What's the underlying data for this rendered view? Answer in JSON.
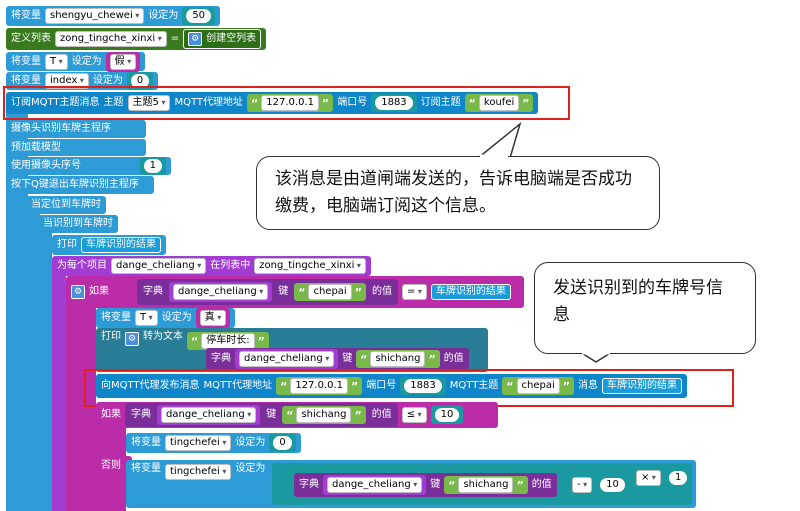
{
  "blocks": {
    "set_var": "将变量",
    "set_to": "设定为",
    "var_shengyu": "shengyu_chewei",
    "val_50": "50",
    "define_list": "定义列表",
    "list_name": "zong_tingche_xinxi",
    "eq": "=",
    "create_empty_list": "创建空列表",
    "var_T": "T",
    "val_false": "假",
    "var_index": "index",
    "val_0": "0",
    "subscribe_label": "订阅MQTT主题消息",
    "topic_label": "主题",
    "topic_value": "主题5",
    "mqtt_addr_label": "MQTT代理地址",
    "mqtt_addr": "127.0.0.1",
    "port_label": "端口号",
    "port": "1883",
    "sub_topic_label": "订阅主题",
    "sub_topic": "koufei",
    "plate_program": "摄像头识别车牌主程序",
    "preload_model": "预加载模型",
    "use_camera": "使用摄像头序号",
    "camera_index": "1",
    "press_q": "按下Q键退出车牌识别主程序",
    "when_located": "当定位到车牌时",
    "when_recognized": "当识别到车牌时",
    "print": "打印",
    "plate_result": "车牌识别的结果",
    "for_each": "为每个项目",
    "item_var": "dange_cheliang",
    "in_list": "在列表中",
    "if_label": "如果",
    "dict_label": "字典",
    "key_label": "键",
    "key_chepai": "chepai",
    "value_of": "的值",
    "val_true": "真",
    "to_text": "转为文本",
    "parking_time": "停车时长:",
    "key_shichang": "shichang",
    "publish_label": "向MQTT代理发布消息",
    "mqtt_topic_label": "MQTT主题",
    "message_label": "消息",
    "lte": "≤",
    "val_10": "10",
    "var_tingchefei": "tingchefei",
    "else_label": "否则",
    "minus": "-",
    "times": "×",
    "val_1": "1"
  },
  "callouts": {
    "subscribe_note": "该消息是由道闸端发送的，告诉电脑端是否成功缴费，电脑端订阅这个信息。",
    "publish_note": "发送识别到的车牌号信息"
  },
  "colors": {
    "annotation_border": "#e0201a",
    "variable_block": "#2d9bd6",
    "list_block": "#3a7a1e",
    "mqtt_block": "#0f86c9",
    "dict_block": "#7a2e9a",
    "control_block": "#bb2da8"
  }
}
